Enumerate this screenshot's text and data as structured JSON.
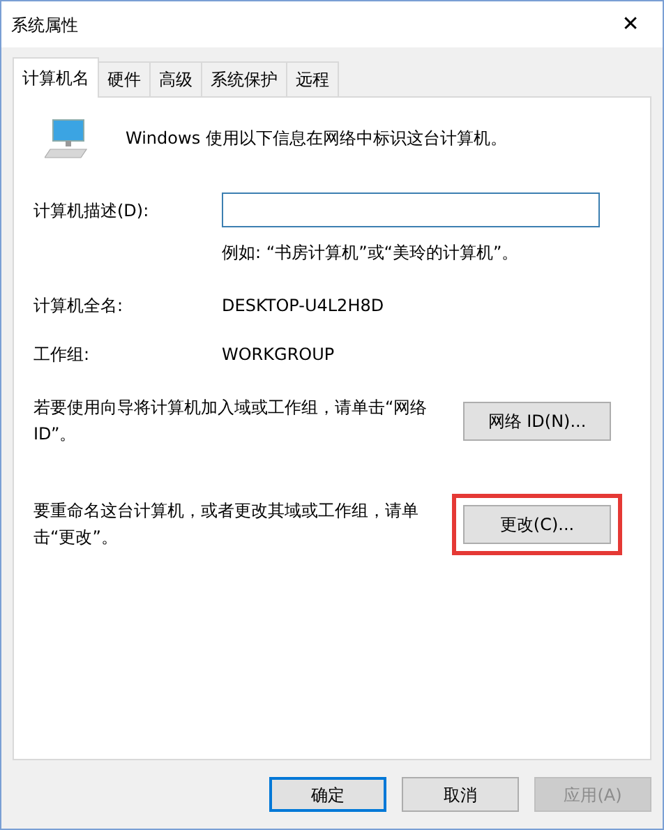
{
  "window": {
    "title": "系统属性",
    "close": "✕"
  },
  "tabs": [
    {
      "label": "计算机名",
      "selected": true
    },
    {
      "label": "硬件",
      "selected": false
    },
    {
      "label": "高级",
      "selected": false
    },
    {
      "label": "系统保护",
      "selected": false
    },
    {
      "label": "远程",
      "selected": false
    }
  ],
  "intro": "Windows 使用以下信息在网络中标识这台计算机。",
  "description": {
    "label": "计算机描述(D):",
    "hint": "例如: “书房计算机”或“美玲的计算机”。"
  },
  "fields": [
    {
      "label": "计算机全名:",
      "value": "DESKTOP-U4L2H8D"
    },
    {
      "label": "工作组:",
      "value": "WORKGROUP"
    }
  ],
  "actions": [
    {
      "text": "若要使用向导将计算机加入域或工作组，请单击“网络 ID”。",
      "button": "网络 ID(N)...",
      "highlighted": false
    },
    {
      "text": "要重命名这台计算机，或者更改其域或工作组，请单击“更改”。",
      "button": "更改(C)...",
      "highlighted": true
    }
  ],
  "buttons": [
    {
      "label": "确定",
      "default": true,
      "disabled": false
    },
    {
      "label": "取消",
      "default": false,
      "disabled": false
    },
    {
      "label": "应用(A)",
      "default": false,
      "disabled": true
    }
  ]
}
